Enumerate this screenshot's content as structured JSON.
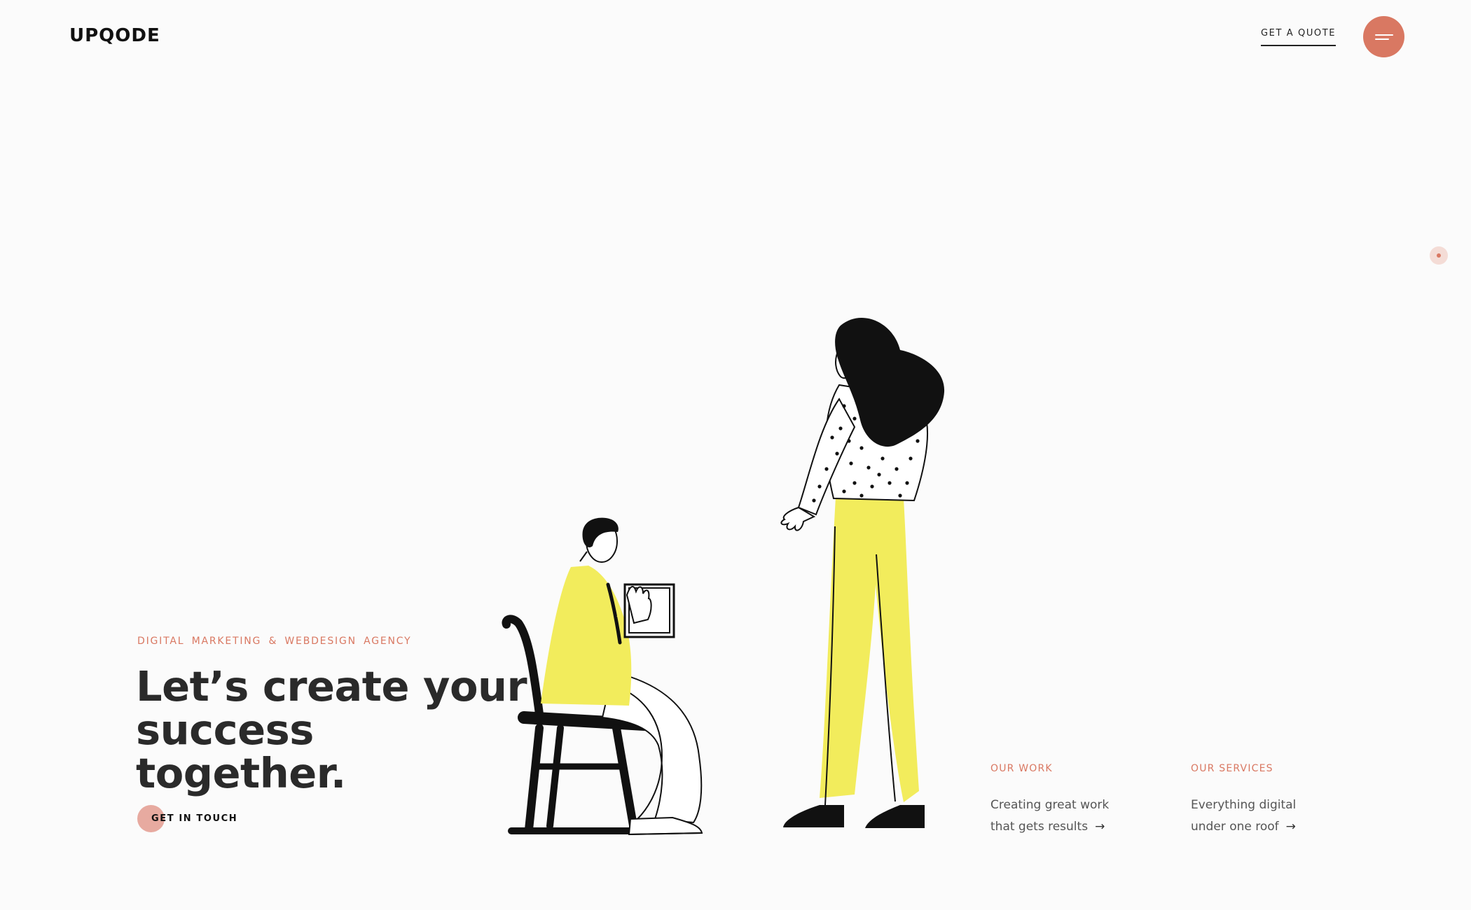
{
  "header": {
    "logo": "UPQODE",
    "quote_label": "GET A QUOTE",
    "menu_icon": "hamburger-menu-icon"
  },
  "colors": {
    "accent": "#d97862",
    "accent_soft": "#e7aaa0",
    "yellow": "#f2ec5c",
    "background": "#fbfbfb"
  },
  "hero": {
    "eyebrow": "DIGITAL MARKETING & WEBDESIGN AGENCY",
    "headline_line1": "Let’s create your",
    "headline_line2": "success together.",
    "cta_label": "GET IN TOUCH"
  },
  "links": {
    "work": {
      "title": "OUR WORK",
      "line1": "Creating great work",
      "line2": "that gets results",
      "arrow": "→"
    },
    "services": {
      "title": "OUR SERVICES",
      "line1": "Everything digital",
      "line2": "under one roof",
      "arrow": "→"
    }
  }
}
